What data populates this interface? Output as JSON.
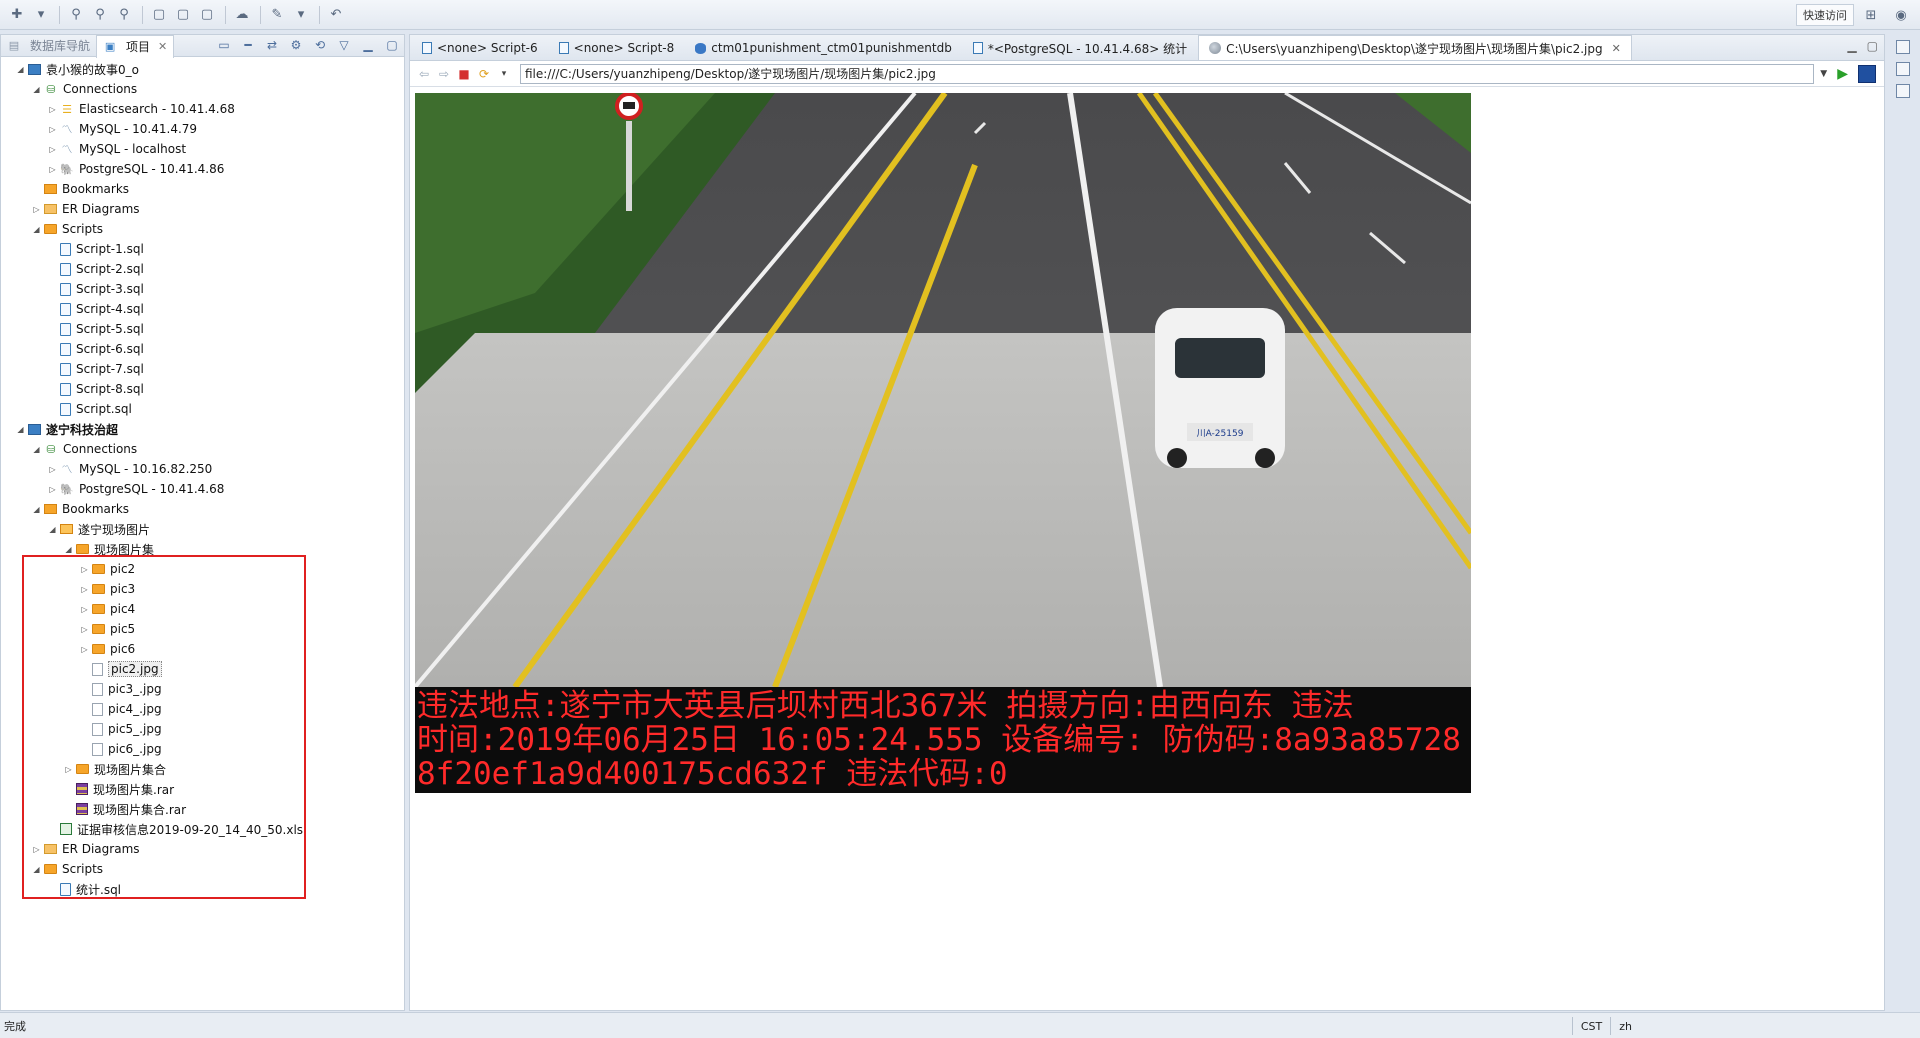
{
  "toolbar": {
    "quick_access": "快速访问"
  },
  "left_panel": {
    "tabs": [
      {
        "label": "数据库导航",
        "active": false
      },
      {
        "label": "项目",
        "active": true
      }
    ]
  },
  "tree": {
    "project1": "袁小猴的故事0_o",
    "p1_connections": "Connections",
    "p1_conn_es": "Elasticsearch - 10.41.4.68",
    "p1_conn_mysql1": "MySQL - 10.41.4.79",
    "p1_conn_mysql2": "MySQL - localhost",
    "p1_conn_pg": "PostgreSQL - 10.41.4.86",
    "p1_bookmarks": "Bookmarks",
    "p1_er": "ER Diagrams",
    "p1_scripts": "Scripts",
    "p1_script_files": [
      "Script-1.sql",
      "Script-2.sql",
      "Script-3.sql",
      "Script-4.sql",
      "Script-5.sql",
      "Script-6.sql",
      "Script-7.sql",
      "Script-8.sql",
      "Script.sql"
    ],
    "project2": "遂宁科技治超",
    "p2_connections": "Connections",
    "p2_conn_mysql": "MySQL - 10.16.82.250",
    "p2_conn_pg": "PostgreSQL - 10.41.4.68",
    "p2_bookmarks": "Bookmarks",
    "bm_folder": "遂宁现场图片",
    "bm_sub": "现场图片集",
    "bm_sub_folders": [
      "pic2",
      "pic3",
      "pic4",
      "pic5",
      "pic6"
    ],
    "bm_sub_files": [
      "pic2.jpg",
      "pic3_.jpg",
      "pic4_.jpg",
      "pic5_.jpg",
      "pic6_.jpg"
    ],
    "bm_sub2": "现场图片集合",
    "bm_rar1": "现场图片集.rar",
    "bm_rar2": "现场图片集合.rar",
    "bm_xls": "证据审核信息2019-09-20_14_40_50.xls",
    "p2_er": "ER Diagrams",
    "p2_scripts": "Scripts",
    "p2_script_file": "统计.sql"
  },
  "editor": {
    "tabs": [
      {
        "label": "<none> Script-6"
      },
      {
        "label": "<none> Script-8"
      },
      {
        "label": "ctm01punishment_ctm01punishmentdb"
      },
      {
        "label": "*<PostgreSQL - 10.41.4.68> 统计"
      },
      {
        "label": "C:\\Users\\yuanzhipeng\\Desktop\\遂宁现场图片\\现场图片集\\pic2.jpg"
      }
    ],
    "url": "file:///C:/Users/yuanzhipeng/Desktop/遂宁现场图片/现场图片集/pic2.jpg"
  },
  "photo": {
    "plate": "川A-25159",
    "caption_line1": "违法地点:遂宁市大英县后坝村西北367米 拍摄方向:由西向东 违法",
    "caption_line2": "时间:2019年06月25日 16:05:24.555 设备编号: 防伪码:8a93a85728",
    "caption_line3": "8f20ef1a9d400175cd632f 违法代码:0"
  },
  "status": {
    "text": "完成",
    "timezone": "CST",
    "locale": "zh"
  },
  "colors": {
    "accent": "#3b7fc4",
    "highlight": "#e02020",
    "caption_text": "#ff2a2a"
  }
}
